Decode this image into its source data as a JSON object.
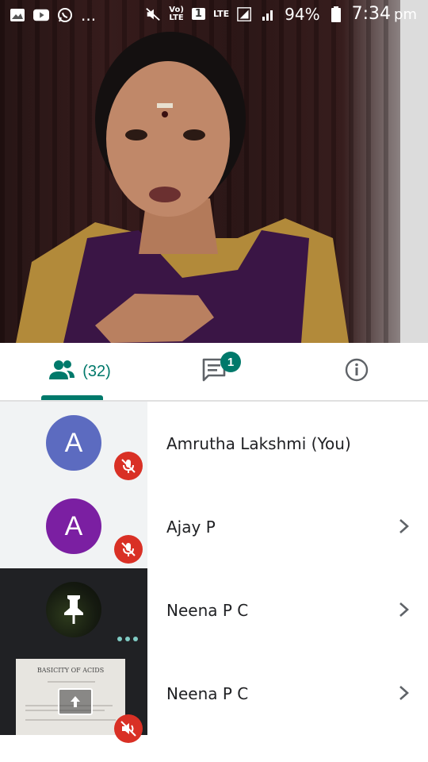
{
  "status_bar": {
    "left_icons": [
      "image-icon",
      "youtube-icon",
      "whatsapp-icon"
    ],
    "more": "...",
    "volte_line1": "Vo)",
    "volte_line2": "LTE",
    "sim": "1",
    "lte_label": "LTE",
    "battery": "94%",
    "time": "7:34",
    "ampm": "pm"
  },
  "tabs": {
    "people_count": "(32)",
    "chat_badge": "1",
    "active": "people"
  },
  "participants": [
    {
      "avatar_letter": "A",
      "avatar_color": "#5c6bc0",
      "name": "Amrutha Lakshmi (You)",
      "mic": "off",
      "chevron": false
    },
    {
      "avatar_letter": "A",
      "avatar_color": "#7b1fa2",
      "name": "Ajay P",
      "mic": "off",
      "chevron": true
    },
    {
      "avatar": "pinned-icon",
      "name": "Neena P C",
      "status": "speaking-dots",
      "chevron": true
    },
    {
      "avatar": "presentation-thumbnail",
      "slide_title": "BASICITY OF ACIDS",
      "name": "Neena P C",
      "audio": "off",
      "chevron": true
    }
  ],
  "colors": {
    "accent": "#00796b",
    "mute_red": "#d93025",
    "list_left_bg": "#f1f3f4",
    "dark_tile": "#202124"
  }
}
